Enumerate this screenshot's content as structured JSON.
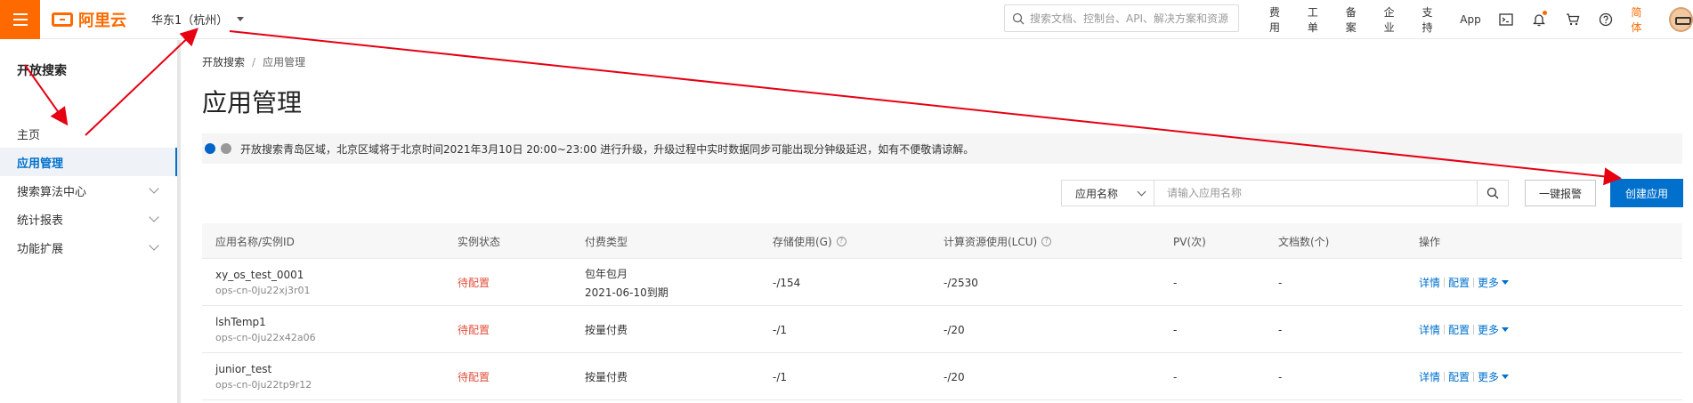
{
  "topbar": {
    "logo_text": "阿里云",
    "region": "华东1（杭州）",
    "search_placeholder": "搜索文档、控制台、API、解决方案和资源",
    "links": [
      "费用",
      "工单",
      "备案",
      "企业",
      "支持",
      "App"
    ],
    "lang": "简体",
    "accent_color": "#ff6a00"
  },
  "sidebar": {
    "title": "开放搜索",
    "items": [
      {
        "label": "主页"
      },
      {
        "label": "应用管理"
      },
      {
        "label": "搜索算法中心"
      },
      {
        "label": "统计报表"
      },
      {
        "label": "功能扩展"
      }
    ]
  },
  "breadcrumb": {
    "root": "开放搜索",
    "sep": "/",
    "current": "应用管理"
  },
  "page_title": "应用管理",
  "notice": "开放搜索青岛区域，北京区域将于北京时间2021年3月10日 20:00~23:00 进行升级，升级过程中实时数据同步可能出现分钟级延迟，如有不便敬请谅解。",
  "filter": {
    "select_value": "应用名称",
    "input_placeholder": "请输入应用名称",
    "alarm_button": "一键报警",
    "create_button": "创建应用",
    "primary_color": "#0070cc"
  },
  "table": {
    "headers": [
      "应用名称/实例ID",
      "实例状态",
      "付费类型",
      "存储使用(G)",
      "计算资源使用(LCU)",
      "PV(次)",
      "文档数(个)",
      "操作"
    ],
    "rows": [
      {
        "name": "xy_os_test_0001",
        "id": "ops-cn-0ju22xj3r01",
        "status": "待配置",
        "pay": "包年包月",
        "pay_sub": "2021-06-10到期",
        "storage": "-/154",
        "lcu": "-/2530",
        "pv": "-",
        "docs": "-",
        "op1": "详情",
        "op2": "配置",
        "op3": "更多"
      },
      {
        "name": "lshTemp1",
        "id": "ops-cn-0ju22x42a06",
        "status": "待配置",
        "pay": "按量付费",
        "pay_sub": "",
        "storage": "-/1",
        "lcu": "-/20",
        "pv": "-",
        "docs": "-",
        "op1": "详情",
        "op2": "配置",
        "op3": "更多"
      },
      {
        "name": "junior_test",
        "id": "ops-cn-0ju22tp9r12",
        "status": "待配置",
        "pay": "按量付费",
        "pay_sub": "",
        "storage": "-/1",
        "lcu": "-/20",
        "pv": "-",
        "docs": "-",
        "op1": "详情",
        "op2": "配置",
        "op3": "更多"
      }
    ],
    "status_color": "#e0503c"
  }
}
